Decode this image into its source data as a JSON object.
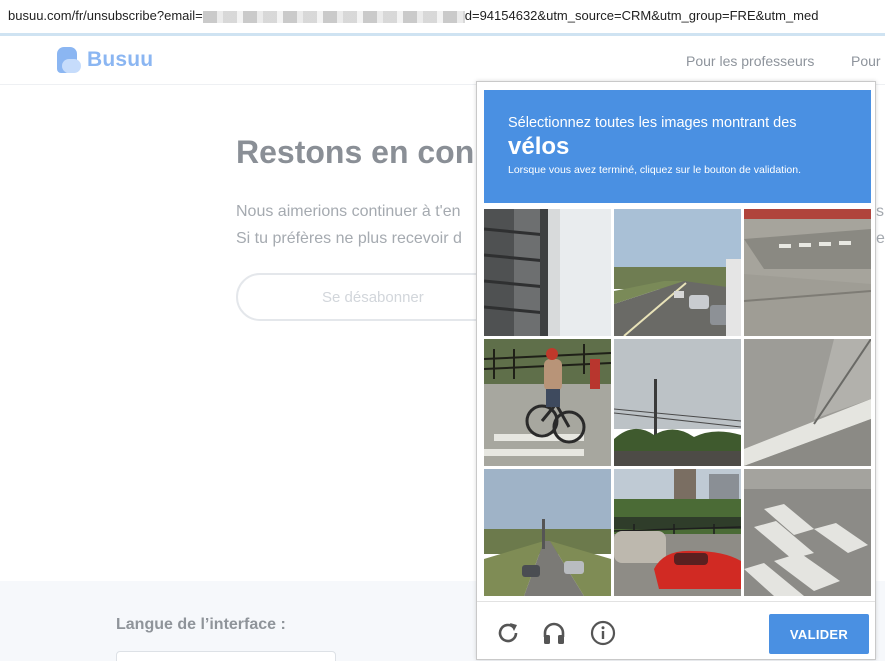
{
  "browser": {
    "url_prefix": "busuu.com/fr/unsubscribe?email=",
    "url_suffix": "d=94154632&utm_source=CRM&utm_group=FRE&utm_med"
  },
  "header": {
    "logo_text": "Busuu",
    "nav": [
      "Pour les professeurs",
      "Pour"
    ]
  },
  "main": {
    "title": "Restons en con",
    "line1": "Nous aimerions continuer à t'en",
    "line2": "Si tu préfères ne plus recevoir d",
    "unsubscribe_label": "Se désabonner",
    "right_fragments": [
      "s",
      "es"
    ]
  },
  "footer": {
    "language_label": "Langue de l’interface :"
  },
  "captcha": {
    "instruction": "Sélectionnez toutes les images montrant des",
    "target": "vélos",
    "hint": "Lorsque vous avez terminé, cliquez sur le bouton de validation.",
    "verify_label": "VALIDER",
    "icons": [
      "reload-icon",
      "audio-headphones-icon",
      "info-icon"
    ]
  },
  "colors": {
    "captcha_blue": "#4a90e2",
    "brand": "#8bb6f2"
  }
}
